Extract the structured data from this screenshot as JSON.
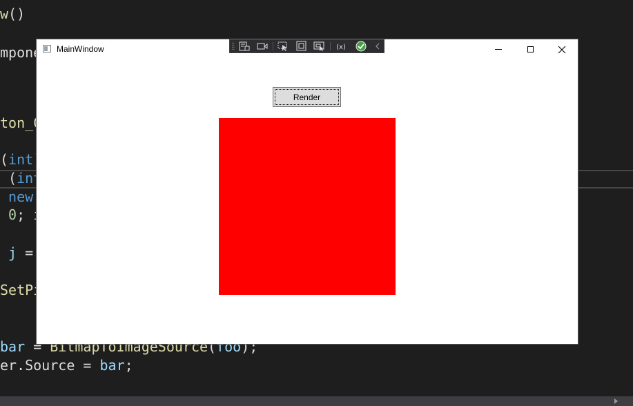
{
  "editor": {
    "lines": [
      {
        "id": "l1",
        "parts": [
          {
            "t": "w",
            "c": "fn"
          },
          {
            "t": "()",
            "c": "plain"
          }
        ]
      },
      {
        "id": "l2",
        "parts": [
          {
            "t": "mpone",
            "c": "plain"
          }
        ]
      },
      {
        "id": "l3",
        "parts": [
          {
            "t": "ton_C",
            "c": "fn"
          }
        ]
      },
      {
        "id": "l4",
        "parts": [
          {
            "t": "(",
            "c": "plain"
          },
          {
            "t": "int",
            "c": "kw"
          },
          {
            "t": ")",
            "c": "plain"
          }
        ]
      },
      {
        "id": "l5",
        "parts": [
          {
            "t": " (",
            "c": "plain"
          },
          {
            "t": "int",
            "c": "kw"
          }
        ]
      },
      {
        "id": "l6",
        "parts": [
          {
            "t": " new",
            "c": "kw"
          }
        ]
      },
      {
        "id": "l7",
        "parts": [
          {
            "t": " 0",
            "c": "num"
          },
          {
            "t": "; i",
            "c": "plain"
          }
        ]
      },
      {
        "id": "l8",
        "parts": [
          {
            "t": " j",
            "c": "var"
          },
          {
            "t": " =",
            "c": "plain"
          }
        ]
      },
      {
        "id": "l9",
        "parts": [
          {
            "t": "SetPi",
            "c": "fn"
          }
        ]
      },
      {
        "id": "l10",
        "parts": [
          {
            "t": "bar",
            "c": "var"
          },
          {
            "t": " = ",
            "c": "plain"
          },
          {
            "t": "BitmapToImageSource",
            "c": "fn"
          },
          {
            "t": "(",
            "c": "plain"
          },
          {
            "t": "foo",
            "c": "var"
          },
          {
            "t": ");",
            "c": "plain"
          }
        ]
      },
      {
        "id": "l11",
        "parts": [
          {
            "t": "er.Source = ",
            "c": "plain"
          },
          {
            "t": "bar",
            "c": "var"
          },
          {
            "t": ";",
            "c": "plain"
          }
        ]
      }
    ]
  },
  "window": {
    "title": "MainWindow",
    "controls": {
      "minimize": "minimize",
      "maximize": "maximize",
      "close": "✕"
    }
  },
  "debug_toolbar": {
    "icons": [
      "live-visual-tree-icon",
      "camera-icon",
      "select-element-icon",
      "display-layout-adorners-icon",
      "track-focus-icon",
      "binding-failures-icon",
      "check-accessibility-icon",
      "collapse-icon"
    ]
  },
  "main": {
    "render_button_label": "Render",
    "image_fill": "#ff0000"
  },
  "colors": {
    "editor_bg": "#1e1e1e",
    "window_bg": "#ffffff",
    "render_red": "#ff0000"
  }
}
